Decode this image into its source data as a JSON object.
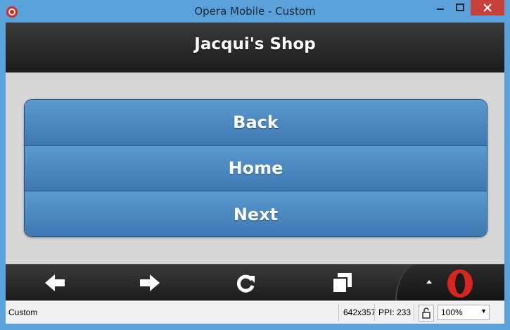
{
  "window": {
    "title": "Opera Mobile - Custom",
    "colors": {
      "frame": "#5aa0d9",
      "close": "#c7403a"
    }
  },
  "page": {
    "header_title": "Jacqui's Shop",
    "buttons": [
      {
        "label": "Back"
      },
      {
        "label": "Home"
      },
      {
        "label": "Next"
      }
    ],
    "colors": {
      "button_top": "#5b99cf",
      "button_bottom": "#3f78b3"
    }
  },
  "toolbar": {
    "icons": [
      "back-arrow-icon",
      "forward-arrow-icon",
      "reload-icon",
      "tabs-icon",
      "menu-up-icon",
      "opera-logo-icon"
    ]
  },
  "statusbar": {
    "profile": "Custom",
    "resolution": "642x357",
    "ppi": "PPI: 233",
    "zoom": "100%"
  }
}
